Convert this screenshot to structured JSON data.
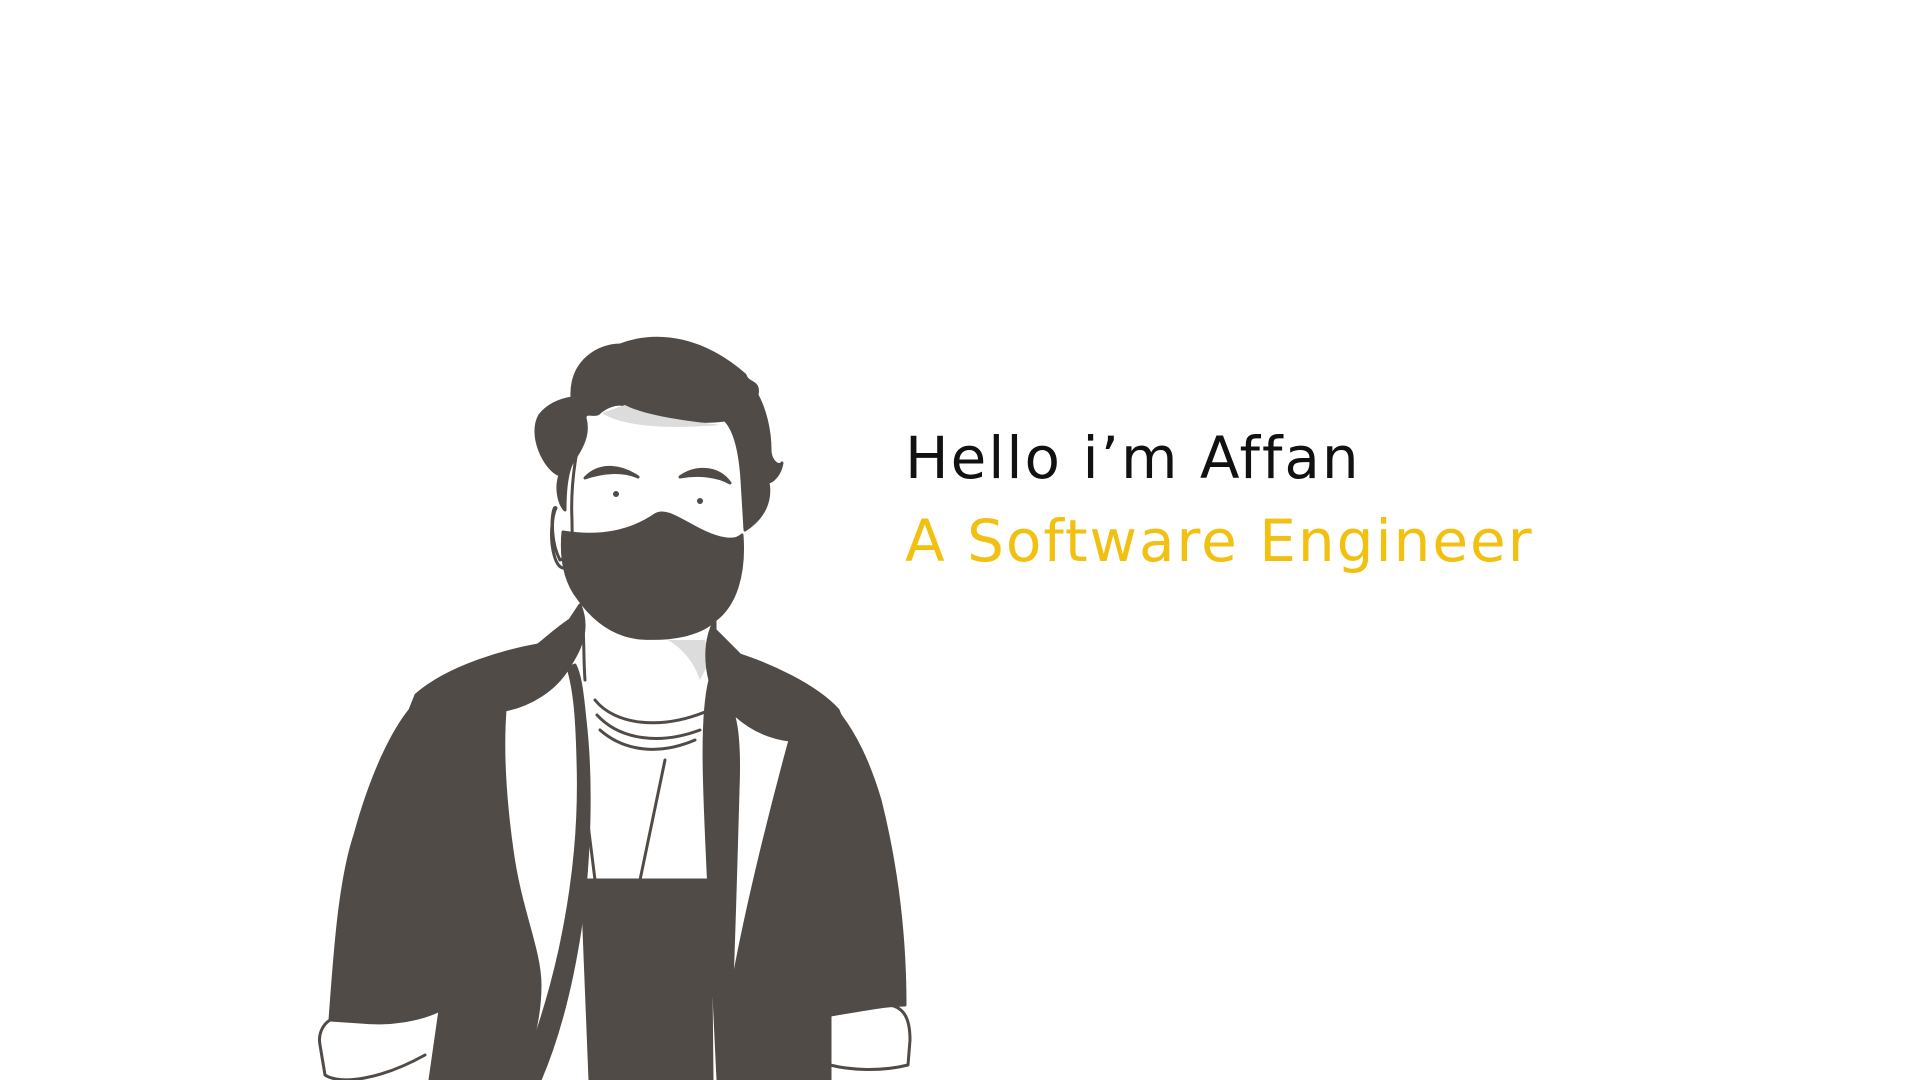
{
  "hero": {
    "greeting": "Hello i’m Affan",
    "role": "A Software Engineer"
  },
  "colors": {
    "background": "#ffffff",
    "greeting_text": "#111111",
    "role_text": "#f2c011",
    "illustration_dark": "#504b47",
    "illustration_light": "#dcdcdc"
  },
  "illustration": {
    "subject": "man-with-beard-illustration"
  }
}
